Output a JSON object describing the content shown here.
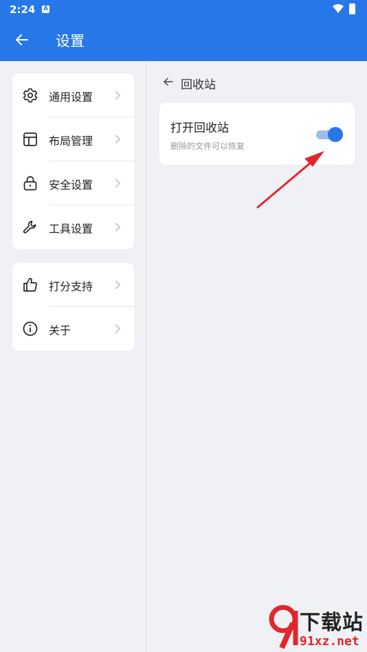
{
  "status_bar": {
    "time": "2:24",
    "notification_letter": "A"
  },
  "app_bar": {
    "title": "设置"
  },
  "menu_groups": [
    [
      {
        "label": "通用设置",
        "icon": "gear-icon"
      },
      {
        "label": "布局管理",
        "icon": "layout-icon"
      },
      {
        "label": "安全设置",
        "icon": "lock-icon"
      },
      {
        "label": "工具设置",
        "icon": "wrench-icon"
      }
    ],
    [
      {
        "label": "打分支持",
        "icon": "thumbs-up-icon"
      },
      {
        "label": "关于",
        "icon": "info-icon"
      }
    ]
  ],
  "detail": {
    "header": "回收站",
    "setting": {
      "title": "打开回收站",
      "description": "删除的文件可以恢复",
      "enabled": true
    }
  },
  "watermark": {
    "name": "下载站",
    "url": "91xz.net"
  },
  "colors": {
    "primary": "#2777e8",
    "background": "#f0f1f4",
    "annotation_arrow": "#e0262d"
  }
}
